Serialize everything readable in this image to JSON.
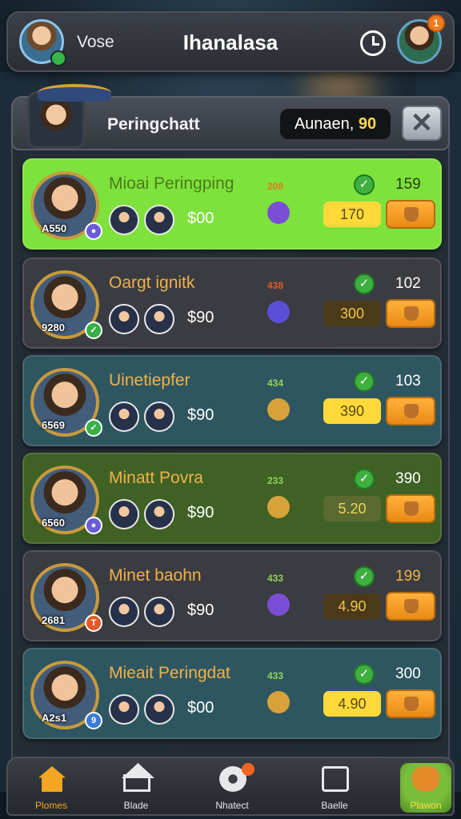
{
  "header": {
    "username": "Vose",
    "title": "Ihanalasa",
    "icons": {
      "left_avatar": "player-avatar",
      "clock": "clock-icon",
      "right_avatar": "friend-avatar"
    },
    "notification_count": "1"
  },
  "panel": {
    "title": "Peringchatt",
    "balance_label": "Aunaen,",
    "balance_value": "90",
    "close_icon": "close-icon"
  },
  "rows": [
    {
      "name": "Mioai Peringping",
      "level": "A550",
      "badge": "●",
      "price": "$00",
      "score": "208",
      "count": "159",
      "amount": "170",
      "bg": "#7ee23c",
      "name_color": "#4a7a1a",
      "score_color": "#e07a22",
      "count_color": "#2a3b15",
      "pill_bg": "#ffd93a",
      "pill_color": "#5a4a10"
    },
    {
      "name": "Oargt ignitk",
      "level": "9280",
      "badge": "✓",
      "price": "$90",
      "score": "438",
      "count": "102",
      "amount": "300",
      "bg": "#3a3c41",
      "name_color": "#f2b04a",
      "score_color": "#e05a2a",
      "count_color": "#ffffff",
      "pill_bg": "#4a3a1a",
      "pill_color": "#f2c44a"
    },
    {
      "name": "Uinetiepfer",
      "level": "6569",
      "badge": "✓",
      "price": "$90",
      "score": "434",
      "count": "103",
      "amount": "390",
      "bg": "#2e5660",
      "name_color": "#f2b04a",
      "score_color": "#8fd35a",
      "count_color": "#ffffff",
      "pill_bg": "#ffd93a",
      "pill_color": "#5a4a10"
    },
    {
      "name": "Minatt Povra",
      "level": "6560",
      "badge": "●",
      "price": "$90",
      "score": "233",
      "count": "390",
      "amount": "5.20",
      "bg": "#3f6224",
      "name_color": "#f2b04a",
      "score_color": "#8fd35a",
      "count_color": "#ffffff",
      "pill_bg": "#5a6a30",
      "pill_color": "#f2d45a"
    },
    {
      "name": "Minet baohn",
      "level": "2681",
      "badge": "T",
      "price": "$90",
      "score": "433",
      "count": "199",
      "amount": "4.90",
      "bg": "#3a3c41",
      "name_color": "#f2b04a",
      "score_color": "#8fd35a",
      "count_color": "#f2b04a",
      "pill_bg": "#4a3a1a",
      "pill_color": "#f2c44a"
    },
    {
      "name": "Mieait Peringdat",
      "level": "A2s1",
      "badge": "9",
      "price": "$00",
      "score": "433",
      "count": "300",
      "amount": "4.90",
      "bg": "#2e5660",
      "name_color": "#f2b04a",
      "score_color": "#8fd35a",
      "count_color": "#ffffff",
      "pill_bg": "#ffd93a",
      "pill_color": "#5a4a10"
    }
  ],
  "nav": [
    {
      "label": "Plomes",
      "icon": "home-icon"
    },
    {
      "label": "Blade",
      "icon": "house-outline-icon"
    },
    {
      "label": "Nhatect",
      "icon": "disc-icon"
    },
    {
      "label": "Baelle",
      "icon": "clipboard-icon"
    },
    {
      "label": "Plawon",
      "icon": "pet-icon"
    }
  ]
}
